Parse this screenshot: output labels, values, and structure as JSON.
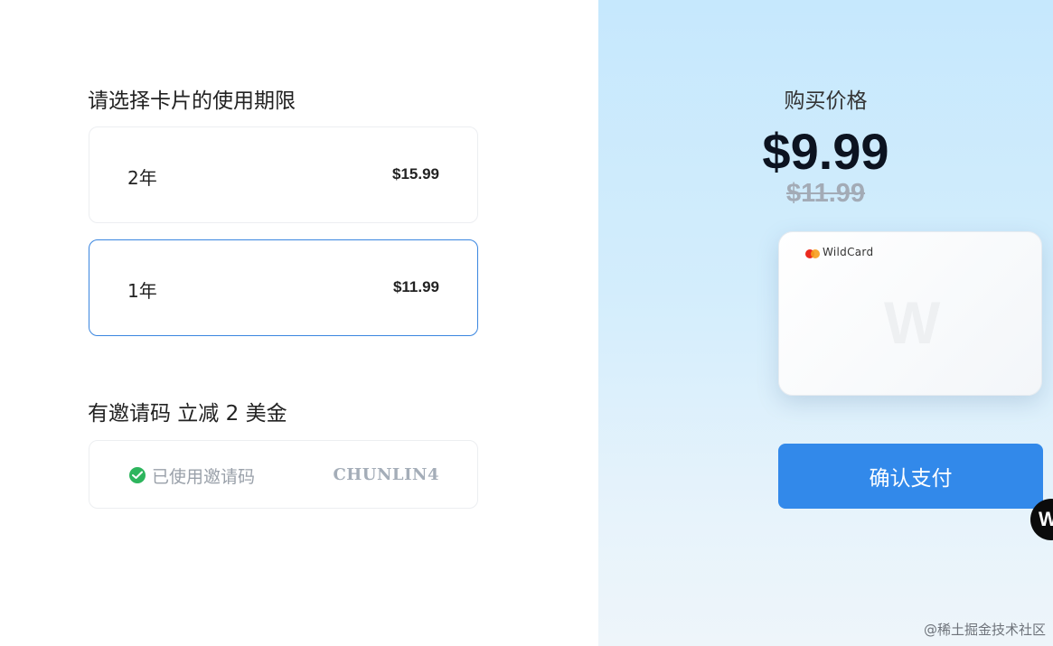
{
  "period_section": {
    "title": "请选择卡片的使用期限",
    "options": [
      {
        "years": "2年",
        "price": "$15.99",
        "selected": false
      },
      {
        "years": "1年",
        "price": "$11.99",
        "selected": true
      }
    ]
  },
  "invite_section": {
    "title": "有邀请码 立减 2 美金",
    "status": "已使用邀请码",
    "code": "CHUNLIN4"
  },
  "summary": {
    "price_label": "购买价格",
    "price_now": "$9.99",
    "price_old": "$11.99"
  },
  "card": {
    "brand": "WildCard",
    "watermark": "W"
  },
  "confirm_button": "确认支付",
  "float_badge": "W",
  "credit": "@稀土掘金技术社区",
  "colors": {
    "accent": "#3289ea",
    "selected_border": "#3a86e0",
    "success": "#2db55d",
    "panel_bg": "#c6e8fd"
  },
  "icons": {
    "coupon_status": "check-circle-icon",
    "card_network": "card-network-logo-icon"
  }
}
